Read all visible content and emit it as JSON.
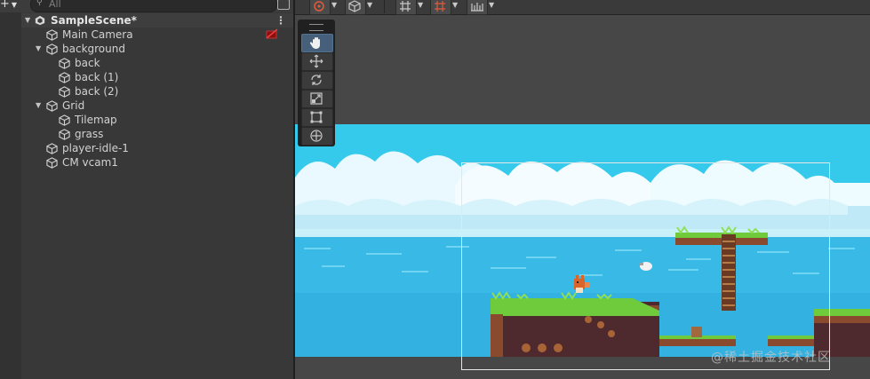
{
  "hierarchy": {
    "add_button": "+",
    "search_placeholder": "All",
    "scene_name": "SampleScene*",
    "items": [
      {
        "label": "Main Camera",
        "depth": 1,
        "expandable": false
      },
      {
        "label": "background",
        "depth": 1,
        "expandable": true
      },
      {
        "label": "back",
        "depth": 2,
        "expandable": false
      },
      {
        "label": "back (1)",
        "depth": 2,
        "expandable": false
      },
      {
        "label": "back (2)",
        "depth": 2,
        "expandable": false
      },
      {
        "label": "Grid",
        "depth": 1,
        "expandable": true
      },
      {
        "label": "Tilemap",
        "depth": 2,
        "expandable": false
      },
      {
        "label": "grass",
        "depth": 2,
        "expandable": false
      },
      {
        "label": "player-idle-1",
        "depth": 1,
        "expandable": false
      },
      {
        "label": "CM vcam1",
        "depth": 1,
        "expandable": false
      }
    ]
  },
  "scene_view": {
    "toolbar_icons": [
      "pivot-icon",
      "global-cube-icon",
      "grid-snap-icon",
      "increment-snap-icon",
      "ruler-icon"
    ],
    "tools": [
      "hand-tool",
      "move-tool",
      "rotate-tool",
      "scale-tool",
      "rect-tool",
      "transform-tool"
    ],
    "active_tool": "hand-tool"
  },
  "watermark": "@稀土掘金技术社区",
  "colors": {
    "panel_bg": "#383838",
    "selected_row": "#3e3e3e",
    "active_tool": "#46607c",
    "sky": "#35c9ec",
    "sea": "#38b9e6",
    "grass": "#6fcb3c",
    "dirt": "#8a4a2e"
  }
}
